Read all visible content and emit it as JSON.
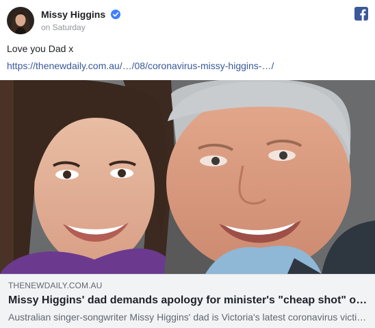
{
  "post": {
    "author_name": "Missy Higgins",
    "verified_icon": "verified-badge-icon",
    "timestamp": "on Saturday",
    "network_icon": "facebook-icon",
    "text": "Love you Dad x",
    "link_url": "https://thenewdaily.com.au/…/08/coronavirus-missy-higgins-…/"
  },
  "link_card": {
    "domain": "THENEWDAILY.COM.AU",
    "title": "Missy Higgins' dad demands apology for minister's \"cheap shot\" o…",
    "description": "Australian singer-songwriter Missy Higgins' dad is Victoria's latest coronavirus victi…"
  },
  "colors": {
    "facebook_blue": "#3b5998",
    "link_blue": "#385898",
    "verified_blue": "#4080ff",
    "card_background": "#f2f3f5",
    "muted_text": "#90949c"
  }
}
